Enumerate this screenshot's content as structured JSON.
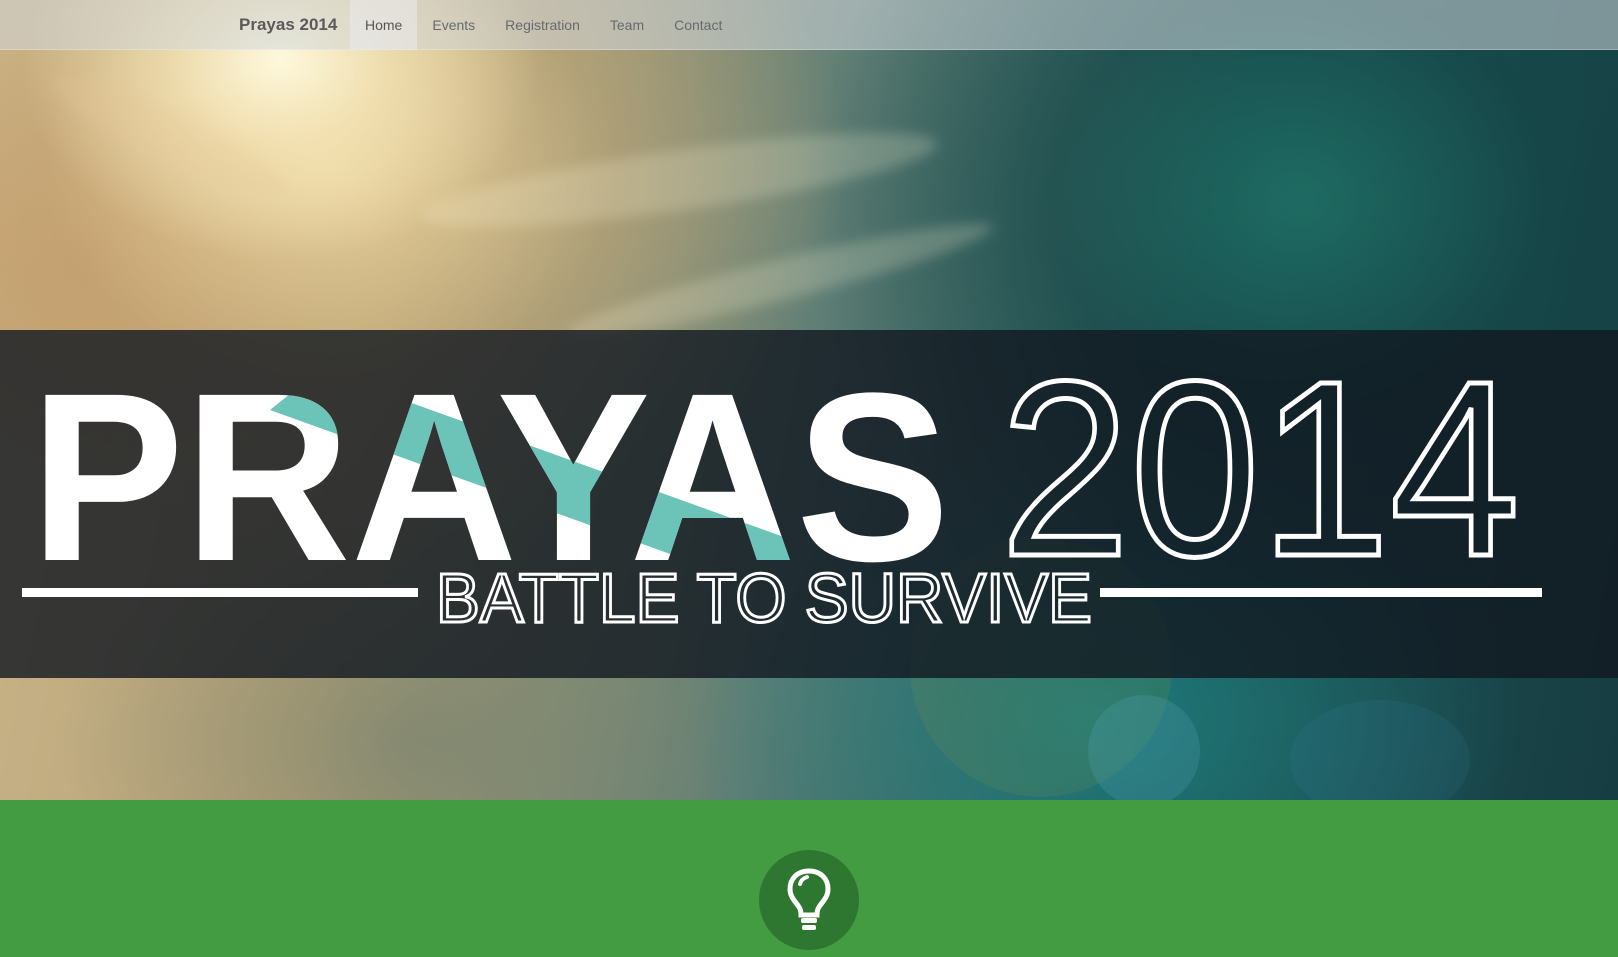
{
  "navbar": {
    "brand": "Prayas 2014",
    "items": [
      {
        "label": "Home",
        "active": true
      },
      {
        "label": "Events",
        "active": false
      },
      {
        "label": "Registration",
        "active": false
      },
      {
        "label": "Team",
        "active": false
      },
      {
        "label": "Contact",
        "active": false
      }
    ]
  },
  "hero": {
    "logo_word": "PRAYAS",
    "logo_year": "2014",
    "tagline": "BATTLE TO SURVIVE"
  },
  "colors": {
    "accent_teal": "#6cc3b8",
    "section_green": "#439c42",
    "icon_circle": "#2e7730"
  },
  "section": {
    "icon": "lightbulb-icon"
  }
}
